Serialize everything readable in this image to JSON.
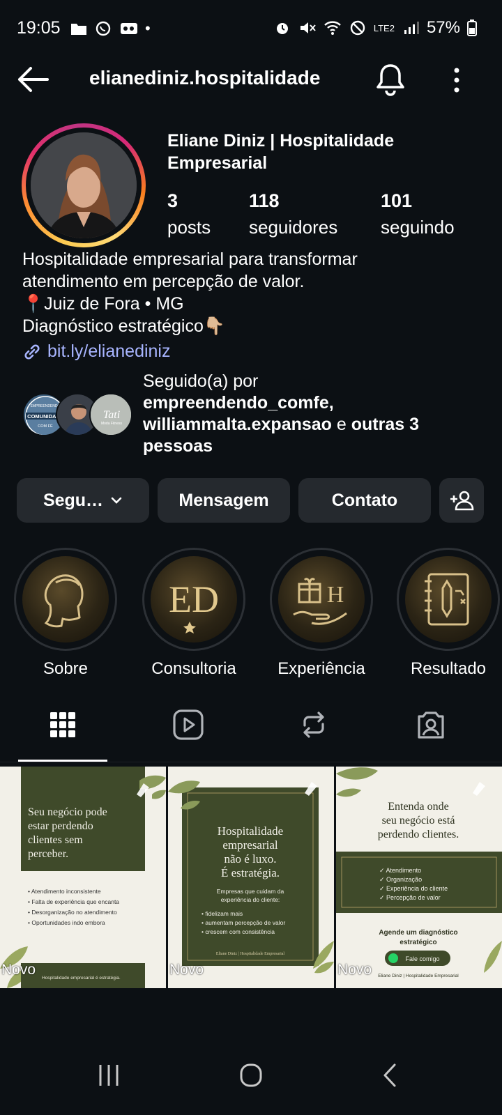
{
  "status_bar": {
    "time": "19:05",
    "network": "LTE2",
    "battery": "57%"
  },
  "header": {
    "username": "elianediniz.hospitalidade",
    "icons": [
      "back-arrow-icon",
      "bell-icon",
      "more-vertical-icon"
    ]
  },
  "profile": {
    "display_name": "Eliane Diniz | Hospitalidade Empresarial",
    "stats": [
      {
        "value": "3",
        "label": "posts"
      },
      {
        "value": "118",
        "label": "seguidores"
      },
      {
        "value": "101",
        "label": "seguindo"
      }
    ],
    "bio_lines": [
      "Hospitalidade empresarial para transformar",
      "atendimento em percepção de valor.",
      "📍Juiz de Fora • MG",
      "Diagnóstico estratégico👇🏼"
    ],
    "link": "bit.ly/elianediniz",
    "followed_by": {
      "prefix": "Seguido(a) por",
      "user1": "empreendendo_comfe,",
      "user2": "williammalta.expansao",
      "connector": " e ",
      "others": "outras 3 pessoas"
    },
    "followed_avatar_texts": {
      "a1_top": "EMPREENDENDO",
      "a1_main": "COMUNIDADE",
      "a1_bottom": "COM FÉ",
      "a3_main": "Tati",
      "a3_sub": "Moda Fitness"
    }
  },
  "actions": {
    "following": "Segu…",
    "message": "Mensagem",
    "contact": "Contato"
  },
  "highlights": [
    {
      "label": "Sobre"
    },
    {
      "label": "Consultoria",
      "monogram": "ED"
    },
    {
      "label": "Experiência",
      "monogram": "H"
    },
    {
      "label": "Resultado"
    }
  ],
  "tabs": [
    "grid-icon",
    "reels-icon",
    "reposts-icon",
    "tagged-icon"
  ],
  "posts": [
    {
      "badge": "Novo",
      "headline": "Seu negócio pode estar perdendo clientes sem perceber.",
      "bullets": [
        "Atendimento inconsistente",
        "Falta de experiência que encanta",
        "Desorganização no atendimento",
        "Oportunidades indo embora"
      ],
      "footer": "Hospitalidade empresarial é estratégia."
    },
    {
      "badge": "Novo",
      "headline": "Hospitalidade empresarial não é luxo. É estratégia.",
      "subtitle": "Empresas que cuidam da experiência do cliente:",
      "bullets": [
        "fidelizam mais",
        "aumentam percepção de valor",
        "crescem com consistência"
      ],
      "footer": "Eliane Diniz | Hospitalidade Empresarial"
    },
    {
      "badge": "Novo",
      "headline": "Entenda onde seu negócio está perdendo clientes.",
      "checks": [
        "Atendimento",
        "Organização",
        "Experiência do cliente",
        "Percepção de valor"
      ],
      "cta": "Agende um diagnóstico estratégico",
      "button": "Fale comigo",
      "footer": "Eliane Diniz | Hospitalidade Empresarial"
    }
  ],
  "colors": {
    "background": "#0c1014",
    "button": "#25292e",
    "link": "#a8b5ff",
    "olive": "#3f4a2a",
    "cream": "#f2f0e8"
  }
}
